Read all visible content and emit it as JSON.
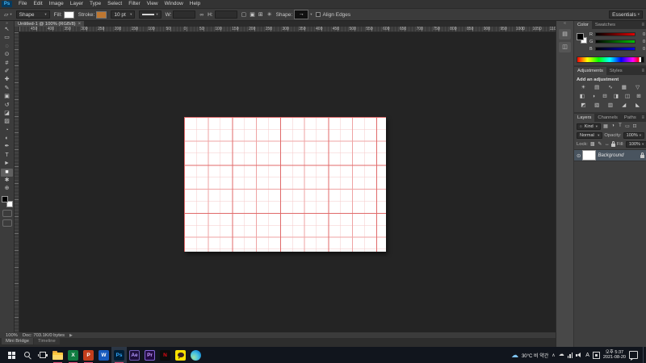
{
  "icons": {
    "dropdown": "▾",
    "double_arrow": "»",
    "collapse": "«",
    "close": "×",
    "menu": "≡",
    "link": "∞",
    "gear": "✳",
    "arrow_right": "▶",
    "eye": "⊙",
    "magnifier": "○",
    "tool_preset": "▱",
    "history_panel": "▤",
    "properties_panel": "◫"
  },
  "menu": {
    "logo": "Ps",
    "items": [
      "File",
      "Edit",
      "Image",
      "Layer",
      "Type",
      "Select",
      "Filter",
      "View",
      "Window",
      "Help"
    ]
  },
  "options": {
    "mode_value": "Shape",
    "fill_label": "Fill:",
    "fill_color": "#ffffff",
    "stroke_label": "Stroke:",
    "stroke_color": "#bf7730",
    "stroke_width_value": "10 pt",
    "w_label": "W:",
    "w_value": "",
    "h_label": "H:",
    "h_value": "",
    "path_ops": [
      {
        "name": "combine-shapes-icon",
        "glyph": "▢"
      },
      {
        "name": "path-alignment-icon",
        "glyph": "▣"
      },
      {
        "name": "path-arrange-icon",
        "glyph": "⊞"
      }
    ],
    "shape_label": "Shape:",
    "shape_preview_glyph": "→",
    "align_edges_label": "Align Edges",
    "workspace": "Essentials"
  },
  "doc_tab": {
    "title": "Untitled-1 @ 100% (RGB/8)"
  },
  "ruler": {
    "h_labels": [
      "450",
      "400",
      "350",
      "300",
      "250",
      "200",
      "150",
      "100",
      "50",
      "0",
      "50",
      "100",
      "150",
      "200",
      "250",
      "300",
      "350",
      "400",
      "450",
      "500",
      "550",
      "600",
      "650",
      "700",
      "750",
      "800",
      "850",
      "900",
      "950",
      "1000",
      "1050",
      "1100"
    ]
  },
  "tools": [
    {
      "name": "move-tool",
      "glyph": "↖"
    },
    {
      "name": "marquee-tool",
      "glyph": "▭"
    },
    {
      "name": "lasso-tool",
      "glyph": "◌"
    },
    {
      "name": "quick-selection-tool",
      "glyph": "⊙"
    },
    {
      "name": "crop-tool",
      "glyph": "#"
    },
    {
      "name": "eyedropper-tool",
      "glyph": "✐"
    },
    {
      "name": "healing-brush-tool",
      "glyph": "✚"
    },
    {
      "name": "brush-tool",
      "glyph": "✎"
    },
    {
      "name": "clone-stamp-tool",
      "glyph": "▣"
    },
    {
      "name": "history-brush-tool",
      "glyph": "↺"
    },
    {
      "name": "eraser-tool",
      "glyph": "◪"
    },
    {
      "name": "gradient-tool",
      "glyph": "▨"
    },
    {
      "name": "blur-tool",
      "glyph": "◔"
    },
    {
      "name": "dodge-tool",
      "glyph": "◐"
    },
    {
      "name": "pen-tool",
      "glyph": "✒"
    },
    {
      "name": "type-tool",
      "glyph": "T"
    },
    {
      "name": "path-selection-tool",
      "glyph": "►"
    },
    {
      "name": "shape-tool",
      "glyph": "■",
      "active": true
    },
    {
      "name": "hand-tool",
      "glyph": "✱"
    },
    {
      "name": "zoom-tool",
      "glyph": "⊕"
    }
  ],
  "foreground_color": "#000000",
  "background_color": "#ffffff",
  "canvas": {
    "grid_major_color": "#e06a6a",
    "grid_mid_color": "#efa3a3",
    "grid_minor_color": "#f6c9c9",
    "paper_color": "#ffffff"
  },
  "panels": {
    "color": {
      "tabs": [
        "Color",
        "Swatches"
      ],
      "channels": [
        {
          "label": "R",
          "value": "0",
          "gradient": "linear-gradient(90deg,#000,#e00000)"
        },
        {
          "label": "G",
          "value": "0",
          "gradient": "linear-gradient(90deg,#000,#00c000)"
        },
        {
          "label": "B",
          "value": "0",
          "gradient": "linear-gradient(90deg,#000,#0000e0)"
        }
      ],
      "spectrum_gradient": "linear-gradient(90deg,#ff0000 0%,#ffff00 15%,#00ff00 32%,#00ffff 49%,#0000ff 66%,#ff00ff 84%,#ff0000 93%,#ffffff 93%,#ffffff 96.5%,#000000 96.5%,#000000 100%)"
    },
    "adjustments": {
      "tabs": [
        "Adjustments",
        "Styles"
      ],
      "title": "Add an adjustment",
      "rows": [
        [
          {
            "name": "brightness-contrast-icon",
            "glyph": "☀"
          },
          {
            "name": "levels-icon",
            "glyph": "▤"
          },
          {
            "name": "curves-icon",
            "glyph": "∿"
          },
          {
            "name": "exposure-icon",
            "glyph": "▦"
          },
          {
            "name": "vibrance-icon",
            "glyph": "▽"
          }
        ],
        [
          {
            "name": "hue-saturation-icon",
            "glyph": "◧"
          },
          {
            "name": "color-balance-icon",
            "glyph": "◑"
          },
          {
            "name": "black-white-icon",
            "glyph": "⊟"
          },
          {
            "name": "photo-filter-icon",
            "glyph": "◨"
          },
          {
            "name": "channel-mixer-icon",
            "glyph": "◫"
          },
          {
            "name": "color-lookup-icon",
            "glyph": "⊞"
          }
        ],
        [
          {
            "name": "invert-icon",
            "glyph": "◩"
          },
          {
            "name": "posterize-icon",
            "glyph": "▧"
          },
          {
            "name": "threshold-icon",
            "glyph": "▥"
          },
          {
            "name": "selective-color-icon",
            "glyph": "◢"
          },
          {
            "name": "gradient-map-icon",
            "glyph": "◣"
          }
        ]
      ]
    },
    "layers": {
      "tabs": [
        "Layers",
        "Channels",
        "Paths"
      ],
      "filter_label": "Kind",
      "filter_icons": [
        {
          "name": "filter-pixel-icon",
          "glyph": "▦"
        },
        {
          "name": "filter-adjustment-icon",
          "glyph": "◑"
        },
        {
          "name": "filter-type-icon",
          "glyph": "T"
        },
        {
          "name": "filter-shape-icon",
          "glyph": "▭"
        },
        {
          "name": "filter-smart-object-icon",
          "glyph": "⊡"
        }
      ],
      "blend_mode": "Normal",
      "opacity_label": "Opacity:",
      "opacity_value": "100%",
      "lock_label": "Lock:",
      "lock_icons": [
        {
          "name": "lock-transparency-icon",
          "glyph": "▩"
        },
        {
          "name": "lock-paint-icon",
          "glyph": "✎"
        },
        {
          "name": "lock-position-icon",
          "glyph": "↔"
        },
        {
          "name": "lock-all-icon",
          "glyph": "lock-shape"
        }
      ],
      "fill_label": "Fill:",
      "fill_value": "100%",
      "layer": {
        "name": "Background",
        "thumb_color": "#ffffff"
      }
    }
  },
  "status": {
    "zoom": "100%",
    "doc_info": "Doc: 703.1K/0 bytes"
  },
  "bottom_tabs": [
    "Mini Bridge",
    "Timeline"
  ],
  "taskbar": {
    "apps": [
      {
        "name": "start-button",
        "type": "start"
      },
      {
        "name": "search-button",
        "type": "search"
      },
      {
        "name": "task-view-button",
        "type": "taskview"
      },
      {
        "name": "file-explorer",
        "type": "folder",
        "running": true
      },
      {
        "name": "excel",
        "type": "tile",
        "label": "X",
        "bg": "#107c41",
        "fg": "#ffffff",
        "running": true
      },
      {
        "name": "powerpoint",
        "type": "tile",
        "label": "P",
        "bg": "#c43e1c",
        "fg": "#ffffff",
        "running": true
      },
      {
        "name": "word",
        "type": "tile",
        "label": "W",
        "bg": "#185abd",
        "fg": "#ffffff"
      },
      {
        "name": "photoshop",
        "type": "tile",
        "label": "Ps",
        "bg": "#001e36",
        "fg": "#31a8ff",
        "active": true,
        "running": true
      },
      {
        "name": "after-effects",
        "type": "tile",
        "label": "Ae",
        "bg": "#1f0f3d",
        "fg": "#b59aff",
        "border": "#6f5bb5"
      },
      {
        "name": "premiere-pro",
        "type": "tile",
        "label": "Pr",
        "bg": "#230b44",
        "fg": "#c79bff",
        "border": "#8465d8"
      },
      {
        "name": "netflix",
        "type": "tile",
        "label": "N",
        "bg": "#0b0b0b",
        "fg": "#e50914"
      },
      {
        "name": "kakaotalk",
        "type": "kakao",
        "bg": "#fae100"
      },
      {
        "name": "edge",
        "type": "edge"
      }
    ],
    "tray": {
      "weather": "30°C 비 약간",
      "chevron": "∧",
      "lang": "A",
      "time": "오후 5:37",
      "date": "2021-08-20"
    },
    "accent_underline": "#e8537f"
  }
}
